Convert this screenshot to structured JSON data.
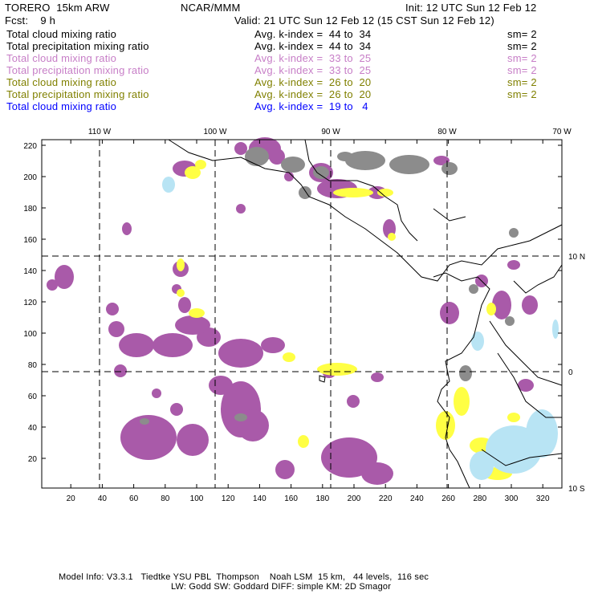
{
  "header": {
    "model": "TORERO  15km ARW",
    "org": "NCAR/MMM",
    "init": "Init: 12 UTC Sun 12 Feb 12",
    "fcst": "Fcst:    9 h",
    "valid": "Valid: 21 UTC Sun 12 Feb 12 (15 CST Sun 12 Feb 12)"
  },
  "legend": [
    {
      "field": "Total cloud mixing ratio",
      "kindex": "Avg. k-index =  44 to  34",
      "sm": "sm= 2",
      "color": "#000000"
    },
    {
      "field": "Total precipitation mixing ratio",
      "kindex": "Avg. k-index =  44 to  34",
      "sm": "sm= 2",
      "color": "#000000"
    },
    {
      "field": "Total cloud mixing ratio",
      "kindex": "Avg. k-index =  33 to  25",
      "sm": "sm= 2",
      "color": "#c77ec7"
    },
    {
      "field": "Total precipitation mixing ratio",
      "kindex": "Avg. k-index =  33 to  25",
      "sm": "sm= 2",
      "color": "#c77ec7"
    },
    {
      "field": "Total cloud mixing ratio",
      "kindex": "Avg. k-index =  26 to  20",
      "sm": "sm= 2",
      "color": "#808000"
    },
    {
      "field": "Total precipitation mixing ratio",
      "kindex": "Avg. k-index =  26 to  20",
      "sm": "sm= 2",
      "color": "#808000"
    },
    {
      "field": "Total cloud mixing ratio",
      "kindex": "Avg. k-index =  19 to   4",
      "sm": "",
      "color": "#0000ff"
    }
  ],
  "map": {
    "lon_labels": [
      "110 W",
      "100 W",
      "90 W",
      "80 W",
      "70 W"
    ],
    "lat_labels": [
      "10 N",
      "0",
      "10 S"
    ],
    "x_ticks": [
      "20",
      "40",
      "60",
      "80",
      "100",
      "120",
      "140",
      "160",
      "180",
      "200",
      "220",
      "240",
      "260",
      "280",
      "300",
      "320"
    ],
    "y_ticks": [
      "220",
      "200",
      "180",
      "160",
      "140",
      "120",
      "100",
      "80",
      "60",
      "40",
      "20"
    ],
    "colors": {
      "purple": "#a95aa9",
      "yellow": "#ffff44",
      "grey": "#8c8c8c",
      "lightblue": "#b8e4f4"
    }
  },
  "footer": {
    "line1": "Model Info: V3.3.1   Tiedtke YSU PBL  Thompson    Noah LSM  15 km,   44 levels,  116 sec",
    "line2": "LW: Godd SW: Goddard DIFF: simple KM: 2D Smagor"
  }
}
